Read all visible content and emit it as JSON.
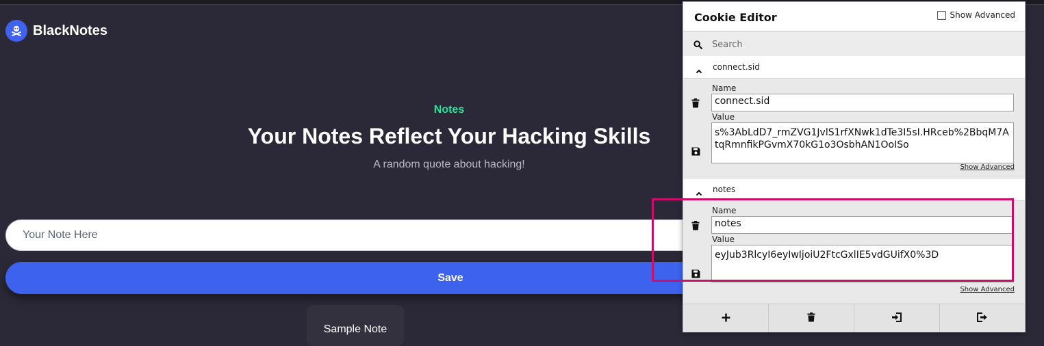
{
  "site": {
    "brand": "BlackNotes"
  },
  "hero": {
    "tag": "Notes",
    "title": "Your Notes Reflect Your Hacking Skills",
    "subtitle": "A random quote about hacking!"
  },
  "note_form": {
    "placeholder": "Your Note Here",
    "save_label": "Save"
  },
  "notes_list": [
    {
      "text": "Sample Note"
    }
  ],
  "cookie_editor": {
    "title": "Cookie Editor",
    "show_advanced_label": "Show Advanced",
    "search_placeholder": "Search",
    "cookies": [
      {
        "header": "connect.sid",
        "name_label": "Name",
        "name": "connect.sid",
        "value_label": "Value",
        "value": "s%3AbLdD7_rmZVG1JvlS1rfXNwk1dTe3I5sI.HRceb%2BbqM7AtqRmnfikPGvmX70kG1o3OsbhAN1OoISo",
        "show_advanced_link": "Show Advanced"
      },
      {
        "header": "notes",
        "name_label": "Name",
        "name": "notes",
        "value_label": "Value",
        "value": "eyJub3RlcyI6eyIwIjoiU2FtcGxlIE5vdGUifX0%3D",
        "show_advanced_link": "Show Advanced"
      }
    ],
    "footer_icons": [
      "plus-icon",
      "trash-icon",
      "import-icon",
      "export-icon"
    ]
  },
  "colors": {
    "background": "#2b2937",
    "accent": "#3d63ee",
    "tag": "#2de39b",
    "highlight": "#c8106b"
  }
}
